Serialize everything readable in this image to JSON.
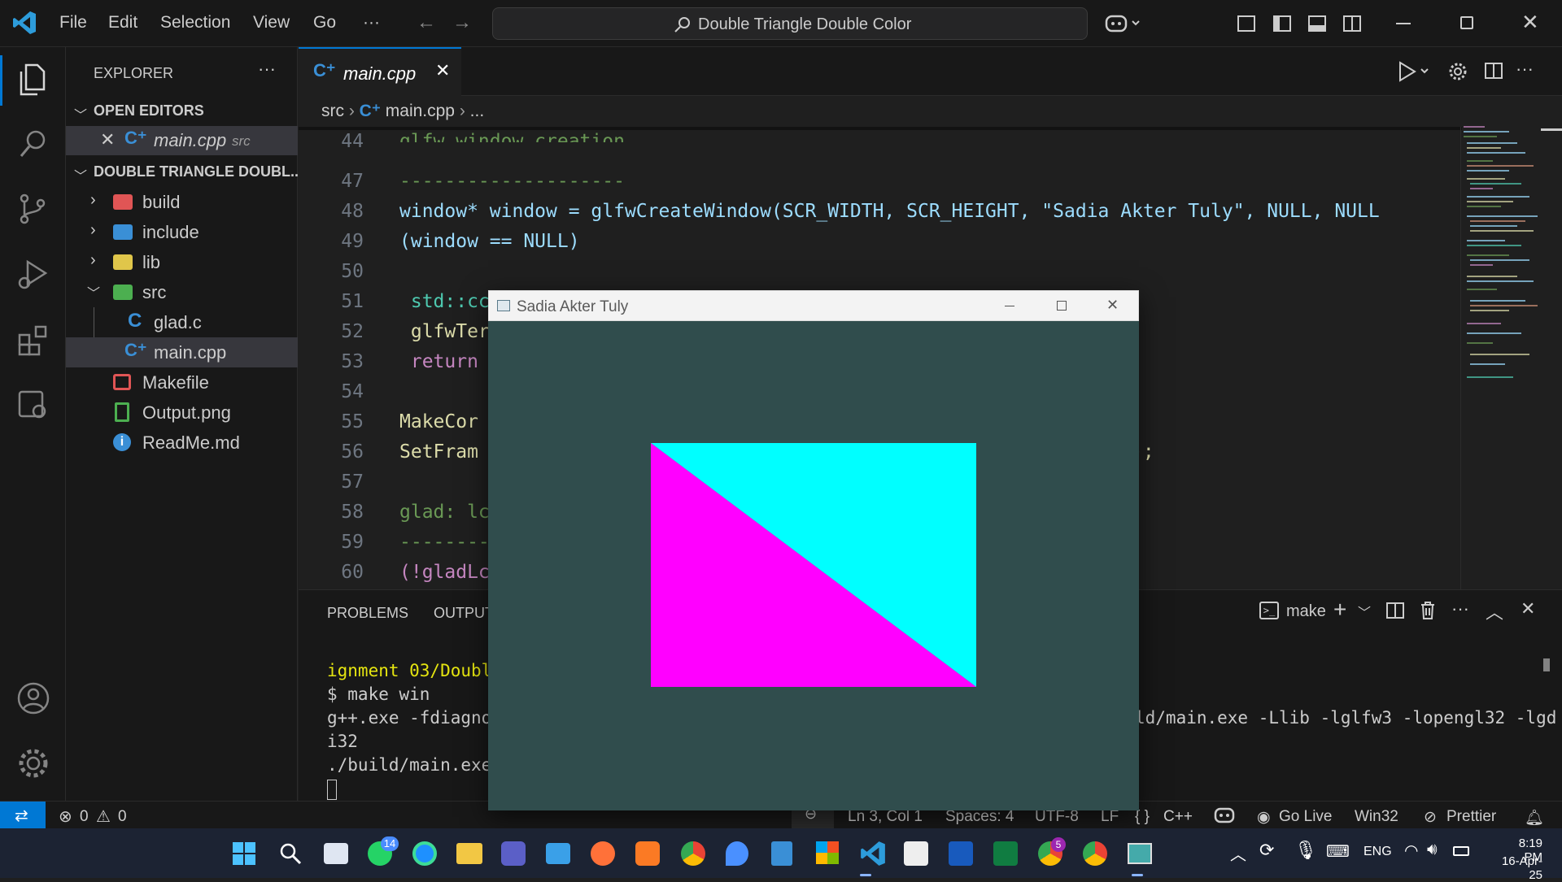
{
  "window": {
    "search_text": "Double Triangle Double Color"
  },
  "menu": [
    "File",
    "Edit",
    "Selection",
    "View",
    "Go",
    "···"
  ],
  "sidebar": {
    "title": "EXPLORER",
    "open_editors_label": "OPEN EDITORS",
    "open_editor": {
      "name": "main.cpp",
      "folder": "src"
    },
    "project_label": "DOUBLE TRIANGLE DOUBL...",
    "items": [
      {
        "label": "build",
        "kind": "folder",
        "color": "#e05555"
      },
      {
        "label": "include",
        "kind": "folder",
        "color": "#3a8fd6"
      },
      {
        "label": "lib",
        "kind": "folder",
        "color": "#e0c64a"
      },
      {
        "label": "src",
        "kind": "folder-open",
        "color": "#4caf50"
      },
      {
        "label": "glad.c",
        "kind": "file-c",
        "color": "#3a8fd6"
      },
      {
        "label": "main.cpp",
        "kind": "file-cpp",
        "color": "#3a8fd6"
      },
      {
        "label": "Makefile",
        "kind": "file-make",
        "color": "#e05555"
      },
      {
        "label": "Output.png",
        "kind": "file-image",
        "color": "#4caf50"
      },
      {
        "label": "ReadMe.md",
        "kind": "file-info",
        "color": "#3a8fd6"
      }
    ]
  },
  "editor": {
    "tab_label": "main.cpp",
    "breadcrumb": [
      "src",
      "main.cpp",
      "..."
    ],
    "lines": [
      {
        "n": "44",
        "text": ""
      },
      {
        "n": "47",
        "text": "--------------------"
      },
      {
        "n": "48",
        "text": "window* window = glfwCreateWindow(SCR_WIDTH, SCR_HEIGHT, \"Sadia Akter Tuly\", NULL, NULL"
      },
      {
        "n": "49",
        "text": "(window == NULL)"
      },
      {
        "n": "50",
        "text": ""
      },
      {
        "n": "51",
        "text": " std::cc"
      },
      {
        "n": "52",
        "text": " glfwTer"
      },
      {
        "n": "53",
        "text": " return"
      },
      {
        "n": "54",
        "text": ""
      },
      {
        "n": "55",
        "text": "MakeCor"
      },
      {
        "n": "56",
        "text": "SetFram"
      },
      {
        "n": "57",
        "text": ""
      },
      {
        "n": "58",
        "text": "glad: lc"
      },
      {
        "n": "59",
        "text": "--------"
      },
      {
        "n": "60",
        "text": "(!gladLc"
      }
    ],
    "line56_tail": ");"
  },
  "panel": {
    "tabs": [
      "PROBLEMS",
      "OUTPUT"
    ],
    "terminal_name": "make",
    "terminal_lines": [
      "ignment 03/Double",
      "$ make win",
      "g++.exe -fdiagnos",
      "i32",
      "./build/main.exe"
    ],
    "terminal_right": "ld/main.exe -Llib -lglfw3 -lopengl32 -lgd"
  },
  "gl_window": {
    "title": "Sadia Akter Tuly",
    "bg_color": "#304d4d",
    "triangle_colors": [
      "#00ffff",
      "#ff00ff"
    ]
  },
  "status": {
    "errors": "0",
    "warnings": "0",
    "position": "Ln 3, Col 1",
    "spaces": "Spaces: 4",
    "encoding": "UTF-8",
    "eol": "LF",
    "language": "C++",
    "golive": "Go Live",
    "platform": "Win32",
    "prettier": "Prettier"
  },
  "taskbar": {
    "time": "8:19 PM",
    "date": "16-Apr-25",
    "lang": "ENG",
    "whatsapp_badge": "14",
    "chrome_badge": "5"
  }
}
